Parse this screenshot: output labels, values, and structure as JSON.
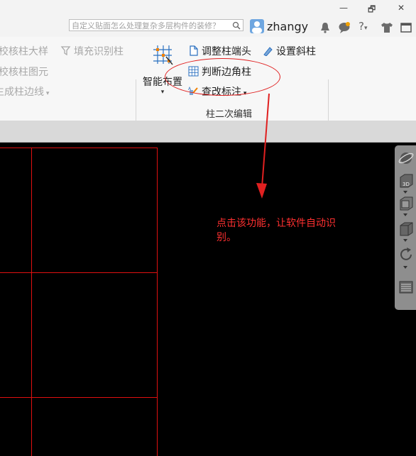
{
  "titlebar": {
    "search_placeholder": "自定义贴面怎么处理复杂多层构件的装修？",
    "username": "zhangy",
    "help_label": "?",
    "window_controls": [
      "—",
      "🗗",
      "✕"
    ]
  },
  "ribbon": {
    "left_items": [
      "校核柱大样",
      "校核柱图元",
      "生成柱边线"
    ],
    "fill_identify": "填充识别柱",
    "smart_layout": "智能布置",
    "adjust_column_end": "调整柱端头",
    "set_inclined_column": "设置斜柱",
    "judge_edge_corner": "判断边角柱",
    "check_modify_label": "查改标注",
    "group_label": "柱二次编辑"
  },
  "annotation": {
    "text": "点击该功能，让软件自动识别。",
    "color": "#ff3030"
  },
  "colors": {
    "grid_line": "#e01010",
    "canvas_bg": "#000000",
    "annotation_red": "#e02020"
  },
  "viewport_toolbar": {
    "buttons": [
      "orbit-icon",
      "3d-view-icon",
      "box-view-icon",
      "cube-icon",
      "rotate-icon",
      "layer-panel-icon"
    ]
  }
}
